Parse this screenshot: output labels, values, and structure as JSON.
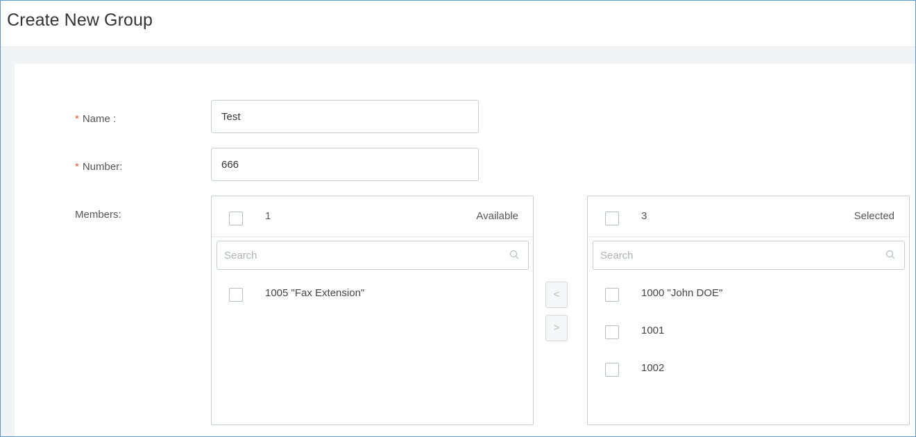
{
  "page": {
    "title": "Create New Group"
  },
  "form": {
    "name": {
      "required_mark": "*",
      "label": "Name :",
      "value": "Test"
    },
    "number": {
      "required_mark": "*",
      "label": "Number:",
      "value": "666"
    },
    "members_label": "Members:"
  },
  "available": {
    "count": "1",
    "title": "Available",
    "search_placeholder": "Search",
    "items": [
      {
        "label": "1005 \"Fax Extension\""
      }
    ]
  },
  "selected": {
    "count": "3",
    "title": "Selected",
    "search_placeholder": "Search",
    "items": [
      {
        "label": "1000 \"John DOE\""
      },
      {
        "label": "1001"
      },
      {
        "label": "1002"
      }
    ]
  },
  "buttons": {
    "move_left": "<",
    "move_right": ">"
  },
  "icons": {
    "search": "search-icon"
  },
  "colors": {
    "frame_border": "#5b9bd5",
    "required": "#e05a45",
    "band": "#f2f3f5"
  }
}
